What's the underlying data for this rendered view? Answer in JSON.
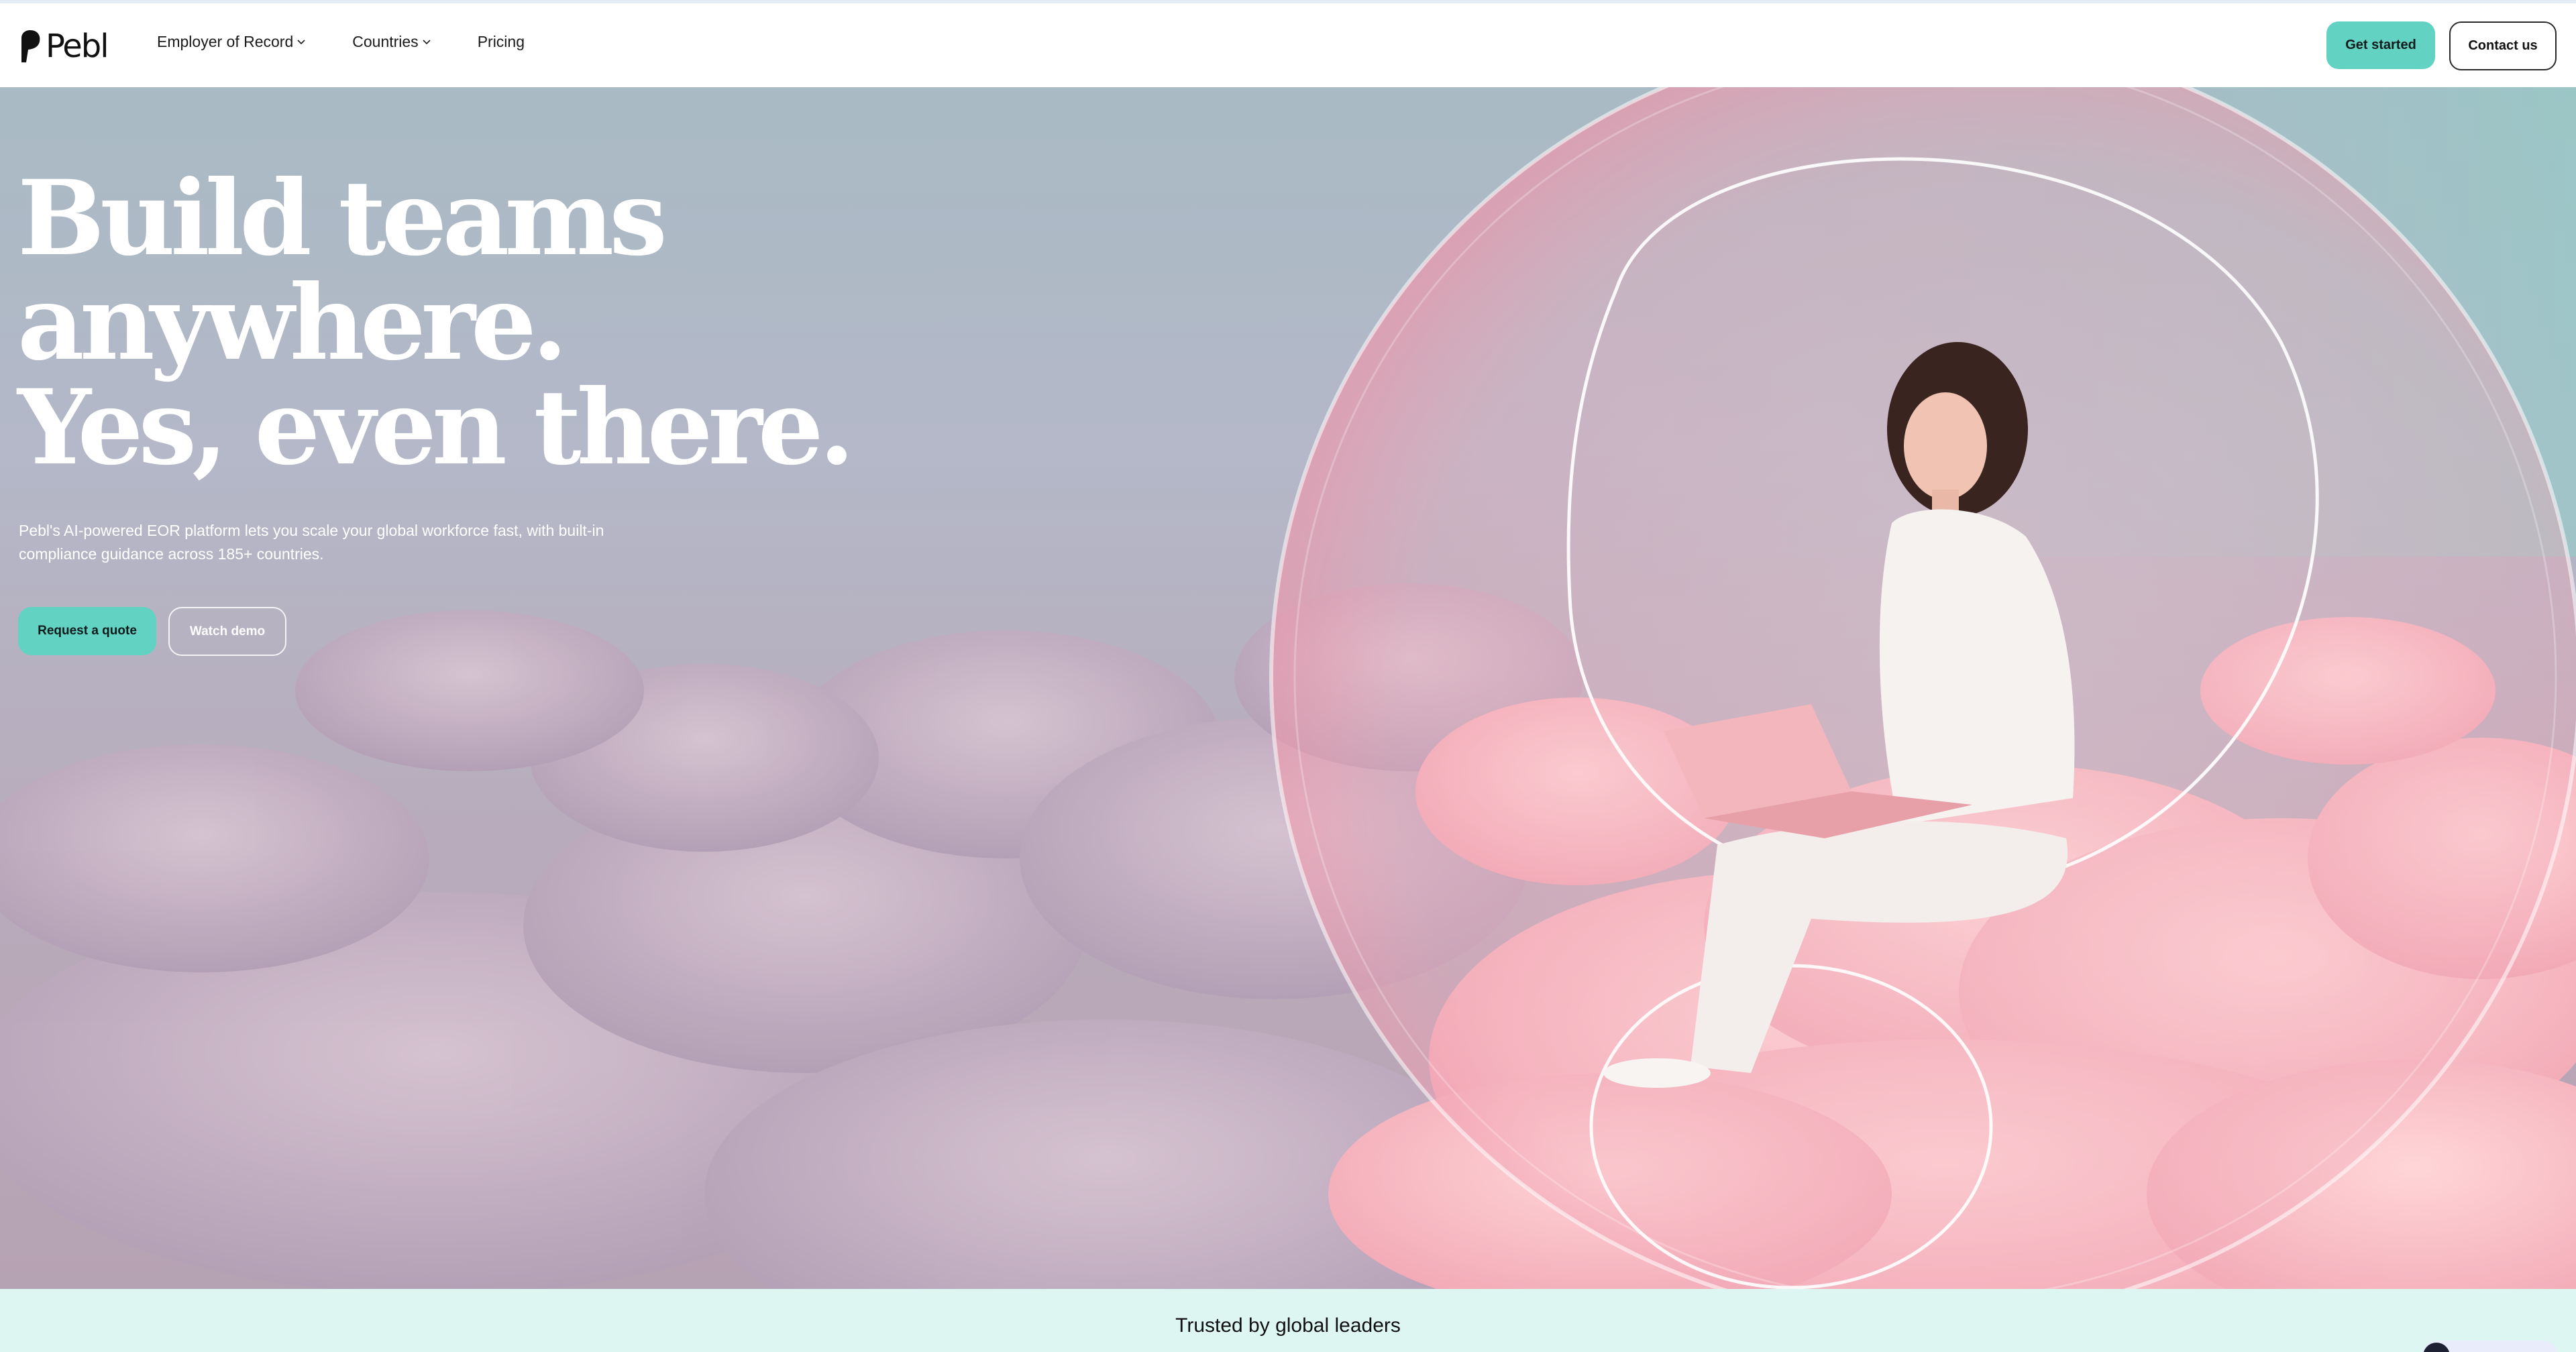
{
  "header": {
    "logo_text": "Pebl",
    "nav": [
      {
        "label": "Employer of Record",
        "has_dropdown": true
      },
      {
        "label": "Countries",
        "has_dropdown": true
      },
      {
        "label": "Pricing",
        "has_dropdown": false
      }
    ],
    "get_started_label": "Get started",
    "contact_label": "Contact us"
  },
  "hero": {
    "headline": [
      "Build teams",
      "anywhere.",
      "Yes, even there."
    ],
    "subtext": "Pebl's AI-powered EOR platform lets you scale your global workforce fast, with built-in compliance guidance across 185+ countries.",
    "primary_button": "Request a quote",
    "secondary_button": "Watch demo"
  },
  "trusted": {
    "label": "Trusted by global leaders"
  },
  "colors": {
    "accent": "#62d2c3",
    "trusted_bg": "#def6f2"
  },
  "icons": [
    "chevron-down-icon",
    "pebl-logo-mark",
    "chat-icon"
  ]
}
